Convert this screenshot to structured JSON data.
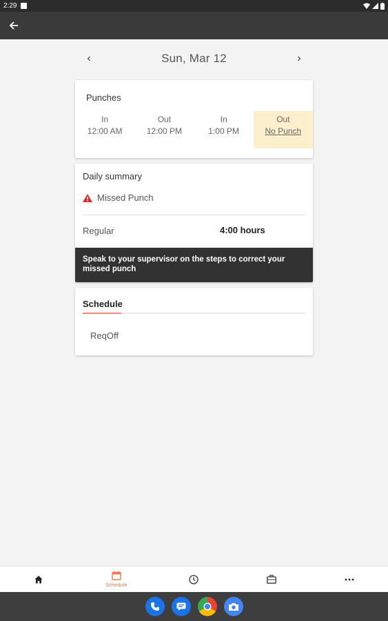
{
  "status_bar": {
    "time": "2:29"
  },
  "date_nav": {
    "prev": "‹",
    "date": "Sun, Mar 12",
    "next": "›"
  },
  "punches": {
    "title": "Punches",
    "items": [
      {
        "label": "In",
        "value": "12:00 AM"
      },
      {
        "label": "Out",
        "value": "12:00 PM"
      },
      {
        "label": "In",
        "value": "1:00 PM"
      },
      {
        "label": "Out",
        "value": "No Punch"
      }
    ]
  },
  "summary": {
    "title": "Daily summary",
    "warning": "Missed Punch",
    "regular_label": "Regular",
    "regular_value": "4:00 hours",
    "toast": "Speak to your supervisor on the steps to correct your missed punch"
  },
  "schedule": {
    "tab": "Schedule",
    "entry": "ReqOff"
  },
  "bottom_nav": {
    "schedule_caption": "Schedule"
  },
  "colors": {
    "accent": "#f07a52",
    "missed_bg": "#fbefcc",
    "warning": "#d32f2f"
  }
}
